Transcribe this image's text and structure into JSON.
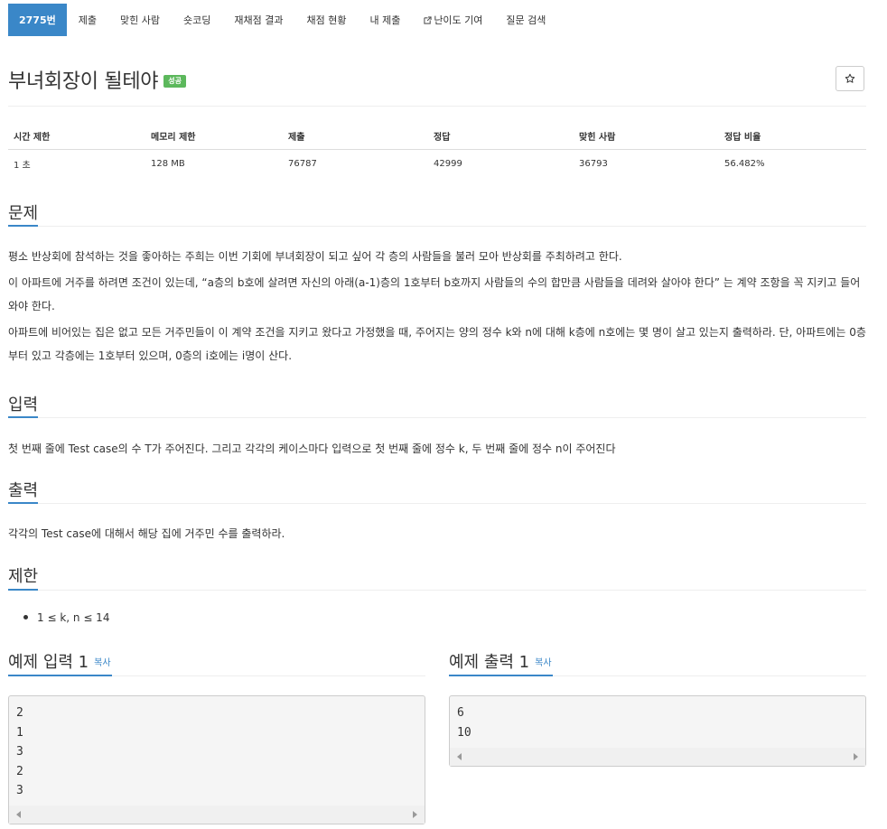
{
  "nav": {
    "tabs": [
      {
        "label": "2775번",
        "active": true
      },
      {
        "label": "제출"
      },
      {
        "label": "맞힌 사람"
      },
      {
        "label": "숏코딩"
      },
      {
        "label": "재채점 결과"
      },
      {
        "label": "채점 현황"
      },
      {
        "label": "내 제출"
      },
      {
        "label": "난이도 기여",
        "icon": "external-link-icon"
      },
      {
        "label": "질문 검색"
      }
    ]
  },
  "problem": {
    "title": "부녀회장이 될테야",
    "badge": "성공",
    "star_icon": "star-icon"
  },
  "stats": {
    "headers": [
      "시간 제한",
      "메모리 제한",
      "제출",
      "정답",
      "맞힌 사람",
      "정답 비율"
    ],
    "values": [
      "1 초",
      "128 MB",
      "76787",
      "42999",
      "36793",
      "56.482%"
    ]
  },
  "sections": {
    "description": {
      "heading": "문제",
      "paragraphs": [
        "평소 반상회에 참석하는 것을 좋아하는 주희는 이번 기회에 부녀회장이 되고 싶어 각 층의 사람들을 불러 모아 반상회를 주최하려고 한다.",
        "이 아파트에 거주를 하려면 조건이 있는데, “a층의 b호에 살려면 자신의 아래(a-1)층의 1호부터 b호까지 사람들의 수의 합만큼 사람들을 데려와 살아야 한다” 는 계약 조항을 꼭 지키고 들어와야 한다.",
        "아파트에 비어있는 집은 없고 모든 거주민들이 이 계약 조건을 지키고 왔다고 가정했을 때, 주어지는 양의 정수 k와 n에 대해 k층에 n호에는 몇 명이 살고 있는지 출력하라. 단, 아파트에는 0층부터 있고 각층에는 1호부터 있으며, 0층의 i호에는 i명이 산다."
      ]
    },
    "input": {
      "heading": "입력",
      "text": "첫 번째 줄에 Test case의 수 T가 주어진다. 그리고 각각의 케이스마다 입력으로 첫 번째 줄에 정수 k, 두 번째 줄에 정수 n이 주어진다"
    },
    "output": {
      "heading": "출력",
      "text": "각각의 Test case에 대해서 해당 집에 거주민 수를 출력하라."
    },
    "limit": {
      "heading": "제한",
      "items": [
        "1 ≤ k, n ≤ 14"
      ]
    }
  },
  "examples": {
    "copy_label": "복사",
    "input": {
      "heading": "예제 입력 1",
      "lines": [
        "2",
        "1",
        "3",
        "2",
        "3"
      ]
    },
    "output": {
      "heading": "예제 출력 1",
      "lines": [
        "6",
        "10"
      ]
    }
  }
}
